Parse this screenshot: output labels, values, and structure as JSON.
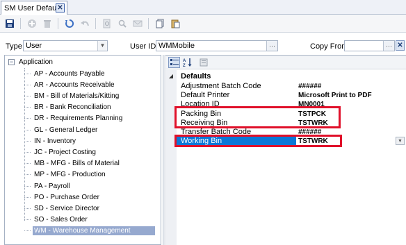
{
  "tab": {
    "title": "SM User Defaults",
    "close_glyph": "✕"
  },
  "toolbar": {
    "buttons": [
      "save-icon",
      "add-icon",
      "delete-icon",
      "refresh-icon",
      "undo-icon",
      "find-icon",
      "find-next-icon",
      "mail-icon",
      "copy-icon",
      "paste-icon"
    ]
  },
  "filters": {
    "type_label": "Type",
    "type_value": "User",
    "userid_label": "User ID",
    "userid_value": "WMMobile",
    "lookup_glyph": "···",
    "copyfrom_label": "Copy From",
    "copyfrom_value": "",
    "clear_glyph": "✕"
  },
  "tree": {
    "root_label": "Application",
    "expander_glyph": "−",
    "items": [
      "AP - Accounts Payable",
      "AR - Accounts Receivable",
      "BM - Bill of Materials/Kitting",
      "BR - Bank Reconciliation",
      "DR - Requirements Planning",
      "GL - General Ledger",
      "IN - Inventory",
      "JC - Project Costing",
      "MB - MFG - Bills of Material",
      "MP - MFG - Production",
      "PA - Payroll",
      "PO - Purchase Order",
      "SD - Service Director",
      "SO - Sales Order",
      "WM - Warehouse Management"
    ],
    "selected_index": 14
  },
  "properties": {
    "category": "Defaults",
    "rows": [
      {
        "name": "Adjustment Batch Code",
        "value": "######"
      },
      {
        "name": "Default Printer",
        "value": "Microsoft Print to PDF"
      },
      {
        "name": "Location ID",
        "value": "MN0001"
      },
      {
        "name": "Packing Bin",
        "value": "TSTPCK"
      },
      {
        "name": "Receiving Bin",
        "value": "TSTWRK"
      },
      {
        "name": "Transfer Batch Code",
        "value": "######"
      },
      {
        "name": "Working Bin",
        "value": "TSTWRK"
      }
    ],
    "selected_index": 6
  },
  "colors": {
    "highlight_box": "#e0102a",
    "selection": "#0b78d7",
    "tree_selection": "#96a9cf"
  }
}
